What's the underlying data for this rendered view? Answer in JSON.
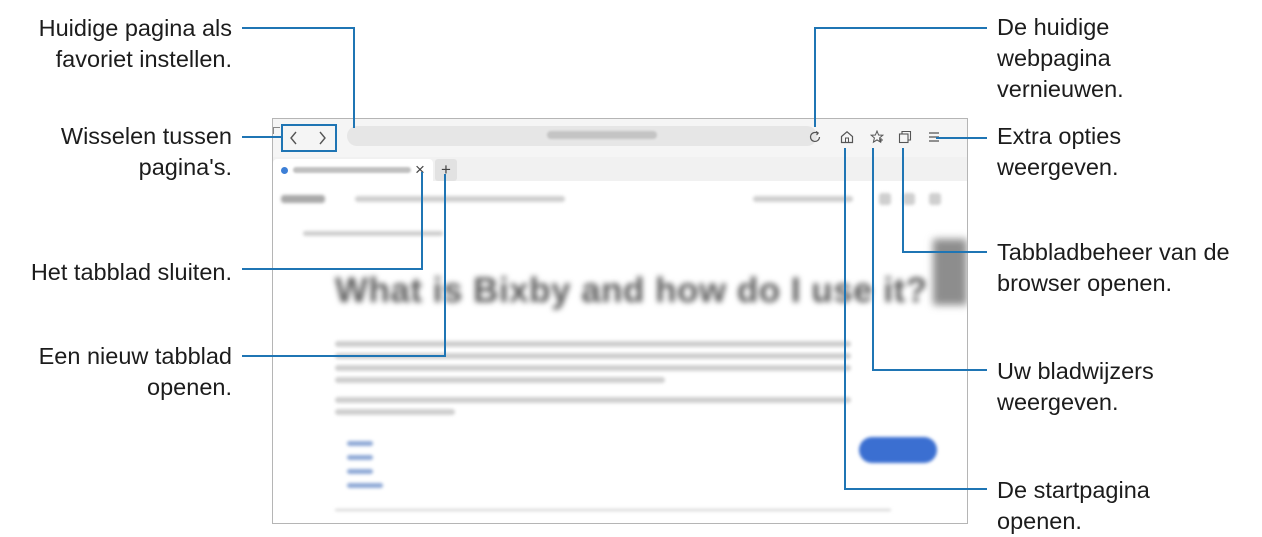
{
  "callouts": {
    "set_favorite": [
      "Huidige pagina als",
      "favoriet instellen."
    ],
    "switch_pages": [
      "Wisselen tussen",
      "pagina's."
    ],
    "close_tab": "Het tabblad sluiten.",
    "new_tab": [
      "Een nieuw tabblad",
      "openen."
    ],
    "refresh": [
      "De huidige",
      "webpagina",
      "vernieuwen."
    ],
    "extra_options": [
      "Extra opties",
      "weergeven."
    ],
    "tab_manager": [
      "Tabbladbeheer van de",
      "browser openen."
    ],
    "bookmarks": [
      "Uw bladwijzers",
      "weergeven."
    ],
    "home": [
      "De startpagina",
      "openen."
    ]
  },
  "browser": {
    "icons": [
      "back-icon",
      "forward-icon",
      "star-icon",
      "refresh-icon",
      "home-icon",
      "bookmarks-icon",
      "tabs-icon",
      "menu-icon",
      "close-tab-icon",
      "plus-icon"
    ],
    "tab_close_glyph": "×",
    "new_tab_glyph": "+",
    "page_headline": "What is Bixby and how do I use it?"
  },
  "colors": {
    "callout_line": "#1f75b4",
    "frame_border": "#b5b5b5",
    "pill_button": "#3b6fd1"
  }
}
